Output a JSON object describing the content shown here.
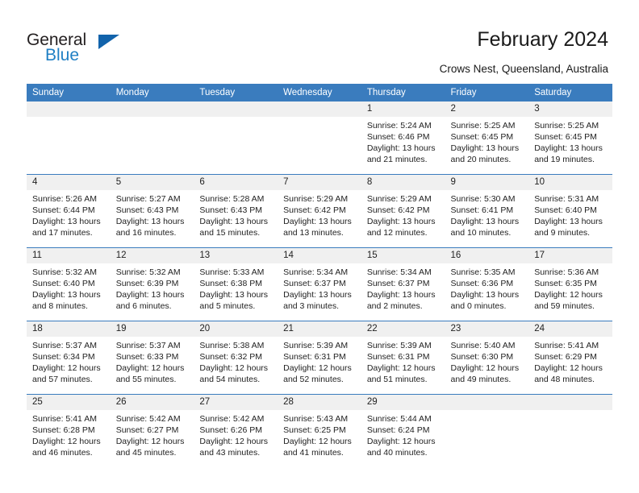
{
  "brand": {
    "name_part1": "General",
    "name_part2": "Blue",
    "triangle_color": "#1263ab",
    "blue_color": "#1f7fc4"
  },
  "header": {
    "title": "February 2024",
    "location": "Crows Nest, Queensland, Australia",
    "header_bg": "#3a7cbe"
  },
  "weekdays": [
    "Sunday",
    "Monday",
    "Tuesday",
    "Wednesday",
    "Thursday",
    "Friday",
    "Saturday"
  ],
  "weeks": [
    [
      {
        "day": "",
        "sunrise": "",
        "sunset": "",
        "daylight_line1": "",
        "daylight_line2": ""
      },
      {
        "day": "",
        "sunrise": "",
        "sunset": "",
        "daylight_line1": "",
        "daylight_line2": ""
      },
      {
        "day": "",
        "sunrise": "",
        "sunset": "",
        "daylight_line1": "",
        "daylight_line2": ""
      },
      {
        "day": "",
        "sunrise": "",
        "sunset": "",
        "daylight_line1": "",
        "daylight_line2": ""
      },
      {
        "day": "1",
        "sunrise": "Sunrise: 5:24 AM",
        "sunset": "Sunset: 6:46 PM",
        "daylight_line1": "Daylight: 13 hours",
        "daylight_line2": "and 21 minutes."
      },
      {
        "day": "2",
        "sunrise": "Sunrise: 5:25 AM",
        "sunset": "Sunset: 6:45 PM",
        "daylight_line1": "Daylight: 13 hours",
        "daylight_line2": "and 20 minutes."
      },
      {
        "day": "3",
        "sunrise": "Sunrise: 5:25 AM",
        "sunset": "Sunset: 6:45 PM",
        "daylight_line1": "Daylight: 13 hours",
        "daylight_line2": "and 19 minutes."
      }
    ],
    [
      {
        "day": "4",
        "sunrise": "Sunrise: 5:26 AM",
        "sunset": "Sunset: 6:44 PM",
        "daylight_line1": "Daylight: 13 hours",
        "daylight_line2": "and 17 minutes."
      },
      {
        "day": "5",
        "sunrise": "Sunrise: 5:27 AM",
        "sunset": "Sunset: 6:43 PM",
        "daylight_line1": "Daylight: 13 hours",
        "daylight_line2": "and 16 minutes."
      },
      {
        "day": "6",
        "sunrise": "Sunrise: 5:28 AM",
        "sunset": "Sunset: 6:43 PM",
        "daylight_line1": "Daylight: 13 hours",
        "daylight_line2": "and 15 minutes."
      },
      {
        "day": "7",
        "sunrise": "Sunrise: 5:29 AM",
        "sunset": "Sunset: 6:42 PM",
        "daylight_line1": "Daylight: 13 hours",
        "daylight_line2": "and 13 minutes."
      },
      {
        "day": "8",
        "sunrise": "Sunrise: 5:29 AM",
        "sunset": "Sunset: 6:42 PM",
        "daylight_line1": "Daylight: 13 hours",
        "daylight_line2": "and 12 minutes."
      },
      {
        "day": "9",
        "sunrise": "Sunrise: 5:30 AM",
        "sunset": "Sunset: 6:41 PM",
        "daylight_line1": "Daylight: 13 hours",
        "daylight_line2": "and 10 minutes."
      },
      {
        "day": "10",
        "sunrise": "Sunrise: 5:31 AM",
        "sunset": "Sunset: 6:40 PM",
        "daylight_line1": "Daylight: 13 hours",
        "daylight_line2": "and 9 minutes."
      }
    ],
    [
      {
        "day": "11",
        "sunrise": "Sunrise: 5:32 AM",
        "sunset": "Sunset: 6:40 PM",
        "daylight_line1": "Daylight: 13 hours",
        "daylight_line2": "and 8 minutes."
      },
      {
        "day": "12",
        "sunrise": "Sunrise: 5:32 AM",
        "sunset": "Sunset: 6:39 PM",
        "daylight_line1": "Daylight: 13 hours",
        "daylight_line2": "and 6 minutes."
      },
      {
        "day": "13",
        "sunrise": "Sunrise: 5:33 AM",
        "sunset": "Sunset: 6:38 PM",
        "daylight_line1": "Daylight: 13 hours",
        "daylight_line2": "and 5 minutes."
      },
      {
        "day": "14",
        "sunrise": "Sunrise: 5:34 AM",
        "sunset": "Sunset: 6:37 PM",
        "daylight_line1": "Daylight: 13 hours",
        "daylight_line2": "and 3 minutes."
      },
      {
        "day": "15",
        "sunrise": "Sunrise: 5:34 AM",
        "sunset": "Sunset: 6:37 PM",
        "daylight_line1": "Daylight: 13 hours",
        "daylight_line2": "and 2 minutes."
      },
      {
        "day": "16",
        "sunrise": "Sunrise: 5:35 AM",
        "sunset": "Sunset: 6:36 PM",
        "daylight_line1": "Daylight: 13 hours",
        "daylight_line2": "and 0 minutes."
      },
      {
        "day": "17",
        "sunrise": "Sunrise: 5:36 AM",
        "sunset": "Sunset: 6:35 PM",
        "daylight_line1": "Daylight: 12 hours",
        "daylight_line2": "and 59 minutes."
      }
    ],
    [
      {
        "day": "18",
        "sunrise": "Sunrise: 5:37 AM",
        "sunset": "Sunset: 6:34 PM",
        "daylight_line1": "Daylight: 12 hours",
        "daylight_line2": "and 57 minutes."
      },
      {
        "day": "19",
        "sunrise": "Sunrise: 5:37 AM",
        "sunset": "Sunset: 6:33 PM",
        "daylight_line1": "Daylight: 12 hours",
        "daylight_line2": "and 55 minutes."
      },
      {
        "day": "20",
        "sunrise": "Sunrise: 5:38 AM",
        "sunset": "Sunset: 6:32 PM",
        "daylight_line1": "Daylight: 12 hours",
        "daylight_line2": "and 54 minutes."
      },
      {
        "day": "21",
        "sunrise": "Sunrise: 5:39 AM",
        "sunset": "Sunset: 6:31 PM",
        "daylight_line1": "Daylight: 12 hours",
        "daylight_line2": "and 52 minutes."
      },
      {
        "day": "22",
        "sunrise": "Sunrise: 5:39 AM",
        "sunset": "Sunset: 6:31 PM",
        "daylight_line1": "Daylight: 12 hours",
        "daylight_line2": "and 51 minutes."
      },
      {
        "day": "23",
        "sunrise": "Sunrise: 5:40 AM",
        "sunset": "Sunset: 6:30 PM",
        "daylight_line1": "Daylight: 12 hours",
        "daylight_line2": "and 49 minutes."
      },
      {
        "day": "24",
        "sunrise": "Sunrise: 5:41 AM",
        "sunset": "Sunset: 6:29 PM",
        "daylight_line1": "Daylight: 12 hours",
        "daylight_line2": "and 48 minutes."
      }
    ],
    [
      {
        "day": "25",
        "sunrise": "Sunrise: 5:41 AM",
        "sunset": "Sunset: 6:28 PM",
        "daylight_line1": "Daylight: 12 hours",
        "daylight_line2": "and 46 minutes."
      },
      {
        "day": "26",
        "sunrise": "Sunrise: 5:42 AM",
        "sunset": "Sunset: 6:27 PM",
        "daylight_line1": "Daylight: 12 hours",
        "daylight_line2": "and 45 minutes."
      },
      {
        "day": "27",
        "sunrise": "Sunrise: 5:42 AM",
        "sunset": "Sunset: 6:26 PM",
        "daylight_line1": "Daylight: 12 hours",
        "daylight_line2": "and 43 minutes."
      },
      {
        "day": "28",
        "sunrise": "Sunrise: 5:43 AM",
        "sunset": "Sunset: 6:25 PM",
        "daylight_line1": "Daylight: 12 hours",
        "daylight_line2": "and 41 minutes."
      },
      {
        "day": "29",
        "sunrise": "Sunrise: 5:44 AM",
        "sunset": "Sunset: 6:24 PM",
        "daylight_line1": "Daylight: 12 hours",
        "daylight_line2": "and 40 minutes."
      },
      {
        "day": "",
        "sunrise": "",
        "sunset": "",
        "daylight_line1": "",
        "daylight_line2": ""
      },
      {
        "day": "",
        "sunrise": "",
        "sunset": "",
        "daylight_line1": "",
        "daylight_line2": ""
      }
    ]
  ]
}
